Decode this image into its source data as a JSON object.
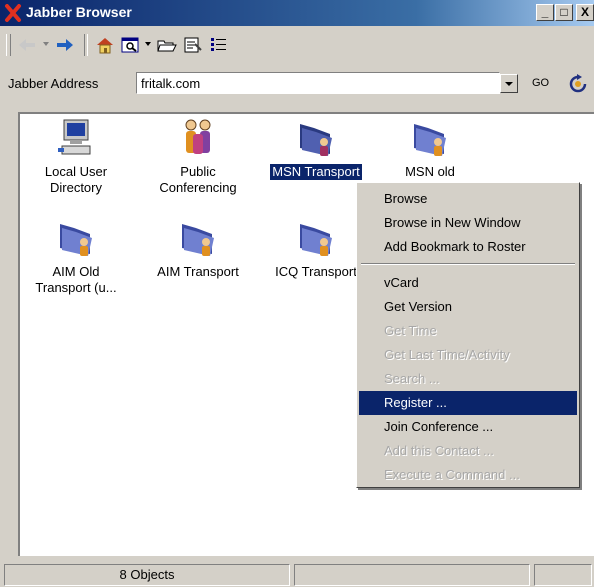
{
  "window": {
    "title": "Jabber Browser"
  },
  "window_buttons": {
    "minimize": "_",
    "maximize": "□",
    "close": "X"
  },
  "address": {
    "label": "Jabber Address",
    "value": "fritalk.com",
    "go": "GO"
  },
  "items": [
    {
      "label_line1": "Local User",
      "label_line2": "Directory",
      "icon": "computer-icon"
    },
    {
      "label_line1": "Public",
      "label_line2": "Conferencing",
      "icon": "people-icon"
    },
    {
      "label_line1": "MSN Transport",
      "label_line2": "",
      "icon": "folder-person-icon",
      "selected": true
    },
    {
      "label_line1": "MSN old",
      "label_line2": "",
      "icon": "folder-person-icon"
    },
    {
      "label_line1": "AIM Old",
      "label_line2": "Transport (u...",
      "icon": "folder-person-icon"
    },
    {
      "label_line1": "AIM Transport",
      "label_line2": "",
      "icon": "folder-person-icon"
    },
    {
      "label_line1": "ICQ Transport",
      "label_line2": "",
      "icon": "folder-person-icon"
    }
  ],
  "context_menu": {
    "items": [
      {
        "label": "Browse",
        "enabled": true
      },
      {
        "label": "Browse in New Window",
        "enabled": true
      },
      {
        "label": "Add Bookmark to Roster",
        "enabled": true
      },
      {
        "label": "vCard",
        "enabled": true
      },
      {
        "label": "Get Version",
        "enabled": true
      },
      {
        "label": "Get Time",
        "enabled": false
      },
      {
        "label": "Get Last Time/Activity",
        "enabled": false
      },
      {
        "label": "Search ...",
        "enabled": false
      },
      {
        "label": "Register ...",
        "enabled": true,
        "highlighted": true
      },
      {
        "label": "Join Conference ...",
        "enabled": true
      },
      {
        "label": "Add this Contact ...",
        "enabled": false
      },
      {
        "label": "Execute a Command ...",
        "enabled": false
      }
    ]
  },
  "status": {
    "objects": "8 Objects"
  },
  "colors": {
    "titlebar": "#0a246a",
    "selection": "#0a246a",
    "face": "#d4d0c8"
  }
}
